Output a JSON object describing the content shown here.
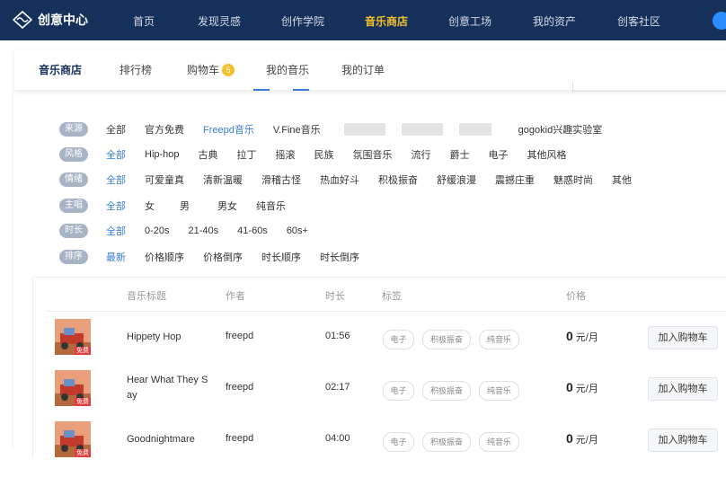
{
  "brand": {
    "name": "创意中心"
  },
  "nav": [
    {
      "label": "首页"
    },
    {
      "label": "发现灵感"
    },
    {
      "label": "创作学院"
    },
    {
      "label": "音乐商店"
    },
    {
      "label": "创意工场"
    },
    {
      "label": "我的资产"
    },
    {
      "label": "创客社区"
    }
  ],
  "subtabs": {
    "store": "音乐商店",
    "ranking": "排行榜",
    "cart": "购物车",
    "cart_count": "5",
    "my_music": "我的音乐",
    "my_orders": "我的订单"
  },
  "filters": {
    "source": {
      "label": "来源",
      "options": [
        "全部",
        "官方免费",
        "Freepd音乐",
        "V.Fine音乐"
      ],
      "extra": "gogokid兴趣实验室"
    },
    "style": {
      "label": "风格",
      "options": [
        "全部",
        "Hip-hop",
        "古典",
        "拉丁",
        "摇滚",
        "民族",
        "氛围音乐",
        "流行",
        "爵士",
        "电子",
        "其他风格"
      ]
    },
    "mood": {
      "label": "情绪",
      "options": [
        "全部",
        "可爱童真",
        "清新温暖",
        "滑稽古怪",
        "热血好斗",
        "积极振奋",
        "舒缓浪漫",
        "震撼庄重",
        "魅惑时尚",
        "其他"
      ]
    },
    "vocal": {
      "label": "主唱",
      "options": [
        "全部",
        "女",
        "男",
        "男女",
        "纯音乐"
      ]
    },
    "duration": {
      "label": "时长",
      "options": [
        "全部",
        "0-20s",
        "21-40s",
        "41-60s",
        "60s+"
      ]
    },
    "sort": {
      "label": "排序",
      "options": [
        "最新",
        "价格顺序",
        "价格倒序",
        "时长顺序",
        "时长倒序"
      ]
    }
  },
  "table": {
    "headers": {
      "title": "音乐标题",
      "author": "作者",
      "duration": "时长",
      "tags": "标签",
      "price": "价格"
    },
    "rows": [
      {
        "title": "Hippety Hop",
        "author": "freepd",
        "duration": "01:56",
        "tags": [
          "电子",
          "积极振奋",
          "纯音乐"
        ],
        "price": "0",
        "unit": "元/月",
        "action": "加入购物车",
        "badge": "免费"
      },
      {
        "title": "Hear What They Say",
        "author": "freepd",
        "duration": "02:17",
        "tags": [
          "电子",
          "积极振奋",
          "纯音乐"
        ],
        "price": "0",
        "unit": "元/月",
        "action": "加入购物车",
        "badge": "免费"
      },
      {
        "title": "Goodnightmare",
        "author": "freepd",
        "duration": "04:00",
        "tags": [
          "电子",
          "积极振奋",
          "纯音乐"
        ],
        "price": "0",
        "unit": "元/月",
        "action": "加入购物车",
        "badge": "免费"
      }
    ]
  },
  "colors": {
    "nav_bg": "#15305a",
    "accent_yellow": "#f5c02a",
    "link_blue": "#3a7bd5",
    "label_pill": "#a9b3c6"
  }
}
